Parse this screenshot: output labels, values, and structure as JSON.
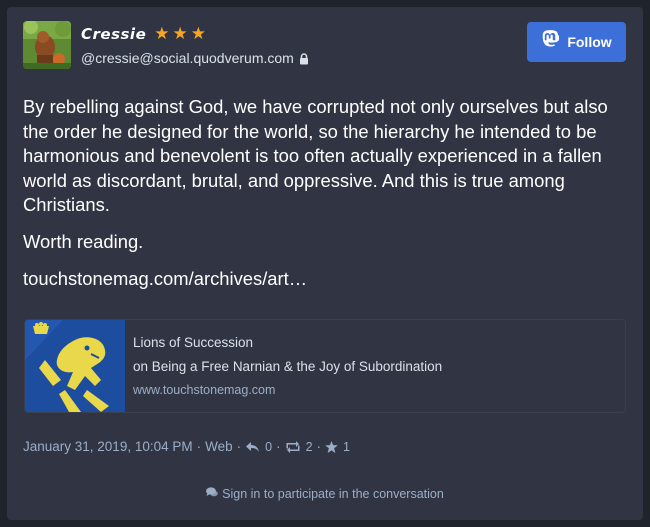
{
  "account": {
    "display_name": "𝘾𝙧𝙚𝙨𝙨𝙞𝙚",
    "stars": "★★★",
    "acct": "@cressie@social.quodverum.com"
  },
  "follow_button": {
    "label": "Follow"
  },
  "status": {
    "paragraphs": [
      "By rebelling against God, we have corrupted not only ourselves but also the order he designed for the world, so the hierarchy he intended to be harmonious and benevolent is too often actually experienced in a fallen world as discordant, brutal, and oppressive. And this is true among Christians.",
      "Worth reading.",
      "touchstonemag.com/archives/art…"
    ]
  },
  "link_card": {
    "title": "Lions of Succession",
    "description": "on Being a Free Narnian & the Joy of Subordination",
    "host": "www.touchstonemag.com"
  },
  "meta": {
    "timestamp": "January 31, 2019, 10:04 PM",
    "application": "Web",
    "replies": "0",
    "reblogs": "2",
    "favourites": "1"
  },
  "footer": {
    "signin_text": "Sign in to participate in the conversation"
  },
  "colors": {
    "card_bg": "#313543",
    "page_bg": "#1f232b",
    "accent": "#3d6fd8",
    "star": "#f5a623"
  }
}
